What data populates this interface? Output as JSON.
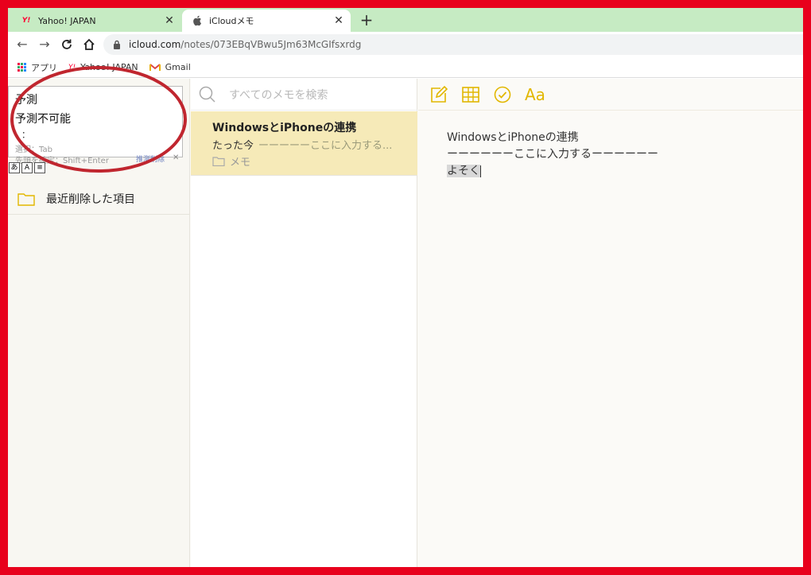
{
  "tabs": [
    {
      "label": "Yahoo! JAPAN",
      "icon": "yahoo-favicon"
    },
    {
      "label": "iCloudメモ",
      "icon": "apple-favicon"
    }
  ],
  "address": {
    "host": "icloud.com",
    "path": "/notes/073EBqVBwu5Jm63McGIfsxrdg"
  },
  "bookmarks": [
    {
      "label": "アプリ"
    },
    {
      "label": "Yahoo! JAPAN"
    },
    {
      "label": "Gmail"
    }
  ],
  "ime": {
    "candidates": [
      "予測",
      "予測不可能"
    ],
    "more": "：",
    "hint_select": "選択：Tab",
    "hint_confirm": "先頭を確定：Shift+Enter",
    "hint_delete": "推測削除"
  },
  "sidebar": {
    "folder_recent": "最近削除した項目"
  },
  "notelist": {
    "search_placeholder": "すべてのメモを検索",
    "note": {
      "title": "WindowsとiPhoneの連携",
      "time": "たった今",
      "preview": "ーーーーーここに入力する...",
      "folder": "メモ"
    }
  },
  "editor": {
    "lines": [
      "WindowsとiPhoneの連携",
      "ーーーーーーここに入力するーーーーーー",
      "よそく"
    ],
    "format_label": "Aa"
  },
  "colors": {
    "accent": "#e2b700",
    "frame": "#e8001c",
    "annotation": "#c0262f"
  }
}
